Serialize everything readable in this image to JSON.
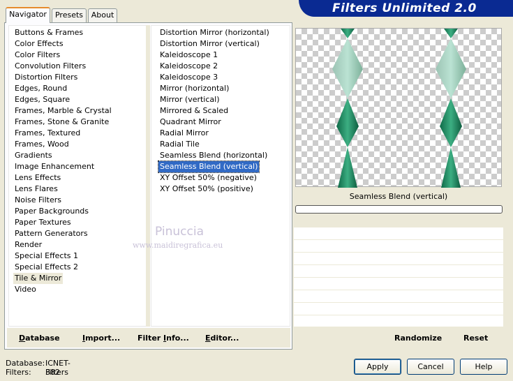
{
  "app": {
    "title": "Filters Unlimited 2.0"
  },
  "tabs": [
    {
      "label": "Navigator",
      "active": true
    },
    {
      "label": "Presets",
      "active": false
    },
    {
      "label": "About",
      "active": false
    }
  ],
  "categories": [
    "Buttons & Frames",
    "Color Effects",
    "Color Filters",
    "Convolution Filters",
    "Distortion Filters",
    "Edges, Round",
    "Edges, Square",
    "Frames, Marble & Crystal",
    "Frames, Stone & Granite",
    "Frames, Textured",
    "Frames, Wood",
    "Gradients",
    "Image Enhancement",
    "Lens Effects",
    "Lens Flares",
    "Noise Filters",
    "Paper Backgrounds",
    "Paper Textures",
    "Pattern Generators",
    "Render",
    "Special Effects 1",
    "Special Effects 2",
    "Tile & Mirror",
    "Video"
  ],
  "selected_category": "Tile & Mirror",
  "filters": [
    "Distortion Mirror (horizontal)",
    "Distortion Mirror (vertical)",
    "Kaleidoscope 1",
    "Kaleidoscope 2",
    "Kaleidoscope 3",
    "Mirror (horizontal)",
    "Mirror (vertical)",
    "Mirrored & Scaled",
    "Quadrant Mirror",
    "Radial Mirror",
    "Radial Tile",
    "Seamless Blend (horizontal)",
    "Seamless Blend (vertical)",
    "XY Offset 50% (negative)",
    "XY Offset 50% (positive)"
  ],
  "selected_filter": "Seamless Blend (vertical)",
  "preview": {
    "filter_name": "Seamless Blend (vertical)",
    "progress": 0,
    "accent_color": "#1e7a56"
  },
  "left_buttons": {
    "database": {
      "underline": "D",
      "rest": "atabase"
    },
    "import": {
      "underline": "I",
      "rest": "mport..."
    },
    "filter_info": {
      "pre": "Filter ",
      "underline": "I",
      "rest": "nfo..."
    },
    "editor": {
      "underline": "E",
      "rest": "ditor..."
    }
  },
  "right_buttons": {
    "randomize": "Randomize",
    "reset": "Reset"
  },
  "info": {
    "database_label": "Database:",
    "database_value": "ICNET-Filters",
    "filters_label": "Filters:",
    "filters_value": "382"
  },
  "dialog_buttons": {
    "apply": "Apply",
    "cancel": "Cancel",
    "help": "Help"
  },
  "watermark": {
    "name": "Pinuccia",
    "url": "www.maidiregrafica.eu"
  }
}
